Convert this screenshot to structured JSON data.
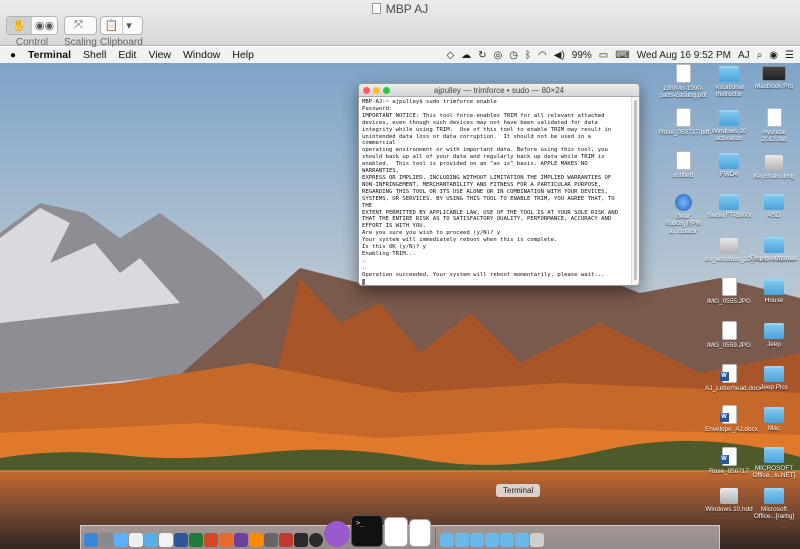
{
  "window": {
    "title": "MBP AJ"
  },
  "toolbar": {
    "control_label": "Control",
    "scaling_label": "Scaling",
    "clipboard_label": "Clipboard"
  },
  "menubar": {
    "apple_icon": "apple-icon",
    "items": [
      "Terminal",
      "Shell",
      "Edit",
      "View",
      "Window",
      "Help"
    ],
    "battery": "99%",
    "datetime": "Wed Aug 16  9:52 PM",
    "user": "AJ"
  },
  "terminal": {
    "title": "ajpulley — trimforce • sudo — 80×24",
    "lines": [
      "MBP-AJ:~ ajpulley$ sudo trimforce enable",
      "Password:",
      "IMPORTANT NOTICE: This tool force-enables TRIM for all relevant attached",
      "devices, even though such devices may not have been validated for data",
      "integrity while using TRIM.  Use of this tool to enable TRIM may result in",
      "unintended data loss or data corruption.  It should not be used in a commercial",
      "operating environment or with important data. Before using this tool, you",
      "should back up all of your data and regularly back up data while TRIM is",
      "enabled.  This tool is provided on an \"as is\" basis. APPLE MAKES NO WARRANTIES,",
      "EXPRESS OR IMPLIED, INCLUDING WITHOUT LIMITATION THE IMPLIED WARRANTIES OF",
      "NON-INFRINGEMENT, MERCHANTABILITY AND FITNESS FOR A PARTICULAR PURPOSE,",
      "REGARDING THIS TOOL OR ITS USE ALONE OR IN COMBINATION WITH YOUR DEVICES,",
      "SYSTEMS, OR SERVICES. BY USING THIS TOOL TO ENABLE TRIM, YOU AGREE THAT, TO THE",
      "EXTENT PERMITTED BY APPLICABLE LAW, USE OF THE TOOL IS AT YOUR SOLE RISK AND",
      "THAT THE ENTIRE RISK AS TO SATISFACTORY QUALITY, PERFORMANCE, ACCURACY AND",
      "EFFORT IS WITH YOU.",
      "Are you sure you wish to proceed (y/N)? y",
      "Your system will immediately reboot when this is complete.",
      "Is this OK (y/N)? y",
      "Enabling TRIM...",
      ".",
      ".",
      "Operation succeeded. Your system will reboot momentarily, please wait..."
    ]
  },
  "desktop_icons": [
    {
      "label": "1988-to-1990-parts-catalog.pdf",
      "kind": "doc"
    },
    {
      "label": "Vocational Instructor",
      "kind": "folder"
    },
    {
      "label": "MacBook Pro",
      "kind": "laptop"
    },
    {
      "label": "Rose_050717.pdf",
      "kind": "doc"
    },
    {
      "label": "Windows 10 activation",
      "kind": "folder"
    },
    {
      "label": "Hyundai 2013.dat",
      "kind": "doc"
    },
    {
      "label": "untitled",
      "kind": "doc"
    },
    {
      "label": "FWD4",
      "kind": "folder"
    },
    {
      "label": "Keychain.dmg",
      "kind": "disk"
    },
    {
      "label": "Gear Ratios_RPM a...culator",
      "kind": "app"
    },
    {
      "label": "Yaesu FT-8900r",
      "kind": "folder"
    },
    {
      "label": "ASD",
      "kind": "folder"
    },
    {
      "label": "en_windows_10_multi...432.iso",
      "kind": "disk"
    },
    {
      "label": "Emplyee Manual",
      "kind": "folder"
    },
    {
      "label": "IMG_0555.JPG",
      "kind": "doc"
    },
    {
      "label": "House",
      "kind": "folder"
    },
    {
      "label": "IMG_0559.JPG",
      "kind": "doc"
    },
    {
      "label": "Jeep",
      "kind": "folder"
    },
    {
      "label": "AJ_Letterhead.docx",
      "kind": "docx"
    },
    {
      "label": "Jeep Pics",
      "kind": "folder"
    },
    {
      "label": "Envelope_AJ.docx",
      "kind": "docx"
    },
    {
      "label": "Mac",
      "kind": "folder"
    },
    {
      "label": "Rose_050717",
      "kind": "docx"
    },
    {
      "label": "MICROSOFT Office...ls.NET]",
      "kind": "folder"
    },
    {
      "label": "Windows 10.hdd",
      "kind": "disk"
    },
    {
      "label": "Microsoft Office...[rarbg]",
      "kind": "folder"
    }
  ],
  "dock": {
    "tooltip": "Terminal"
  },
  "colors": {
    "menubar_bg": "#f0f0f0",
    "close": "#fc5f57",
    "minimize": "#fdbc2e",
    "zoom": "#28c840",
    "folder": "#5ab1e6"
  }
}
